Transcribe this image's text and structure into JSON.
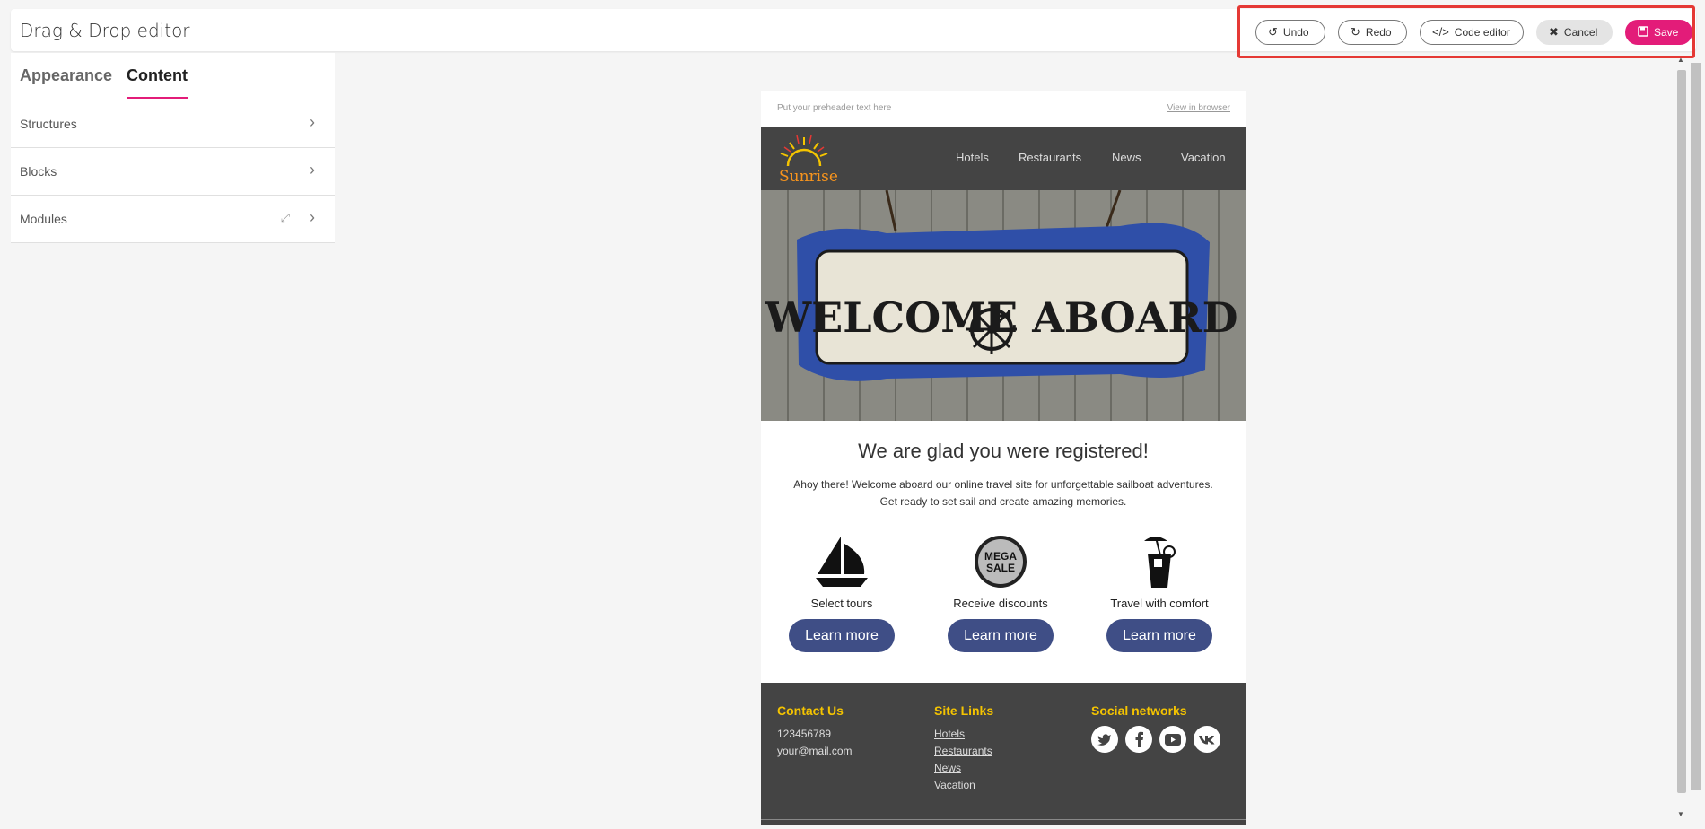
{
  "app": {
    "title": "Drag & Drop editor"
  },
  "toolbar": {
    "undo": "Undo",
    "redo": "Redo",
    "code_editor": "Code editor",
    "cancel": "Cancel",
    "save": "Save",
    "accent_color": "#e31c79",
    "highlight_color": "#e53935"
  },
  "panel": {
    "tabs": [
      "Appearance",
      "Content"
    ],
    "active_tab": "Content",
    "items": [
      {
        "label": "Structures"
      },
      {
        "label": "Blocks"
      },
      {
        "label": "Modules"
      }
    ]
  },
  "email": {
    "preheader": "Put your preheader text here",
    "view_in_browser": "View in browser",
    "logo_text": "Sunrise",
    "nav": [
      "Hotels",
      "Restaurants",
      "News",
      "Vacation"
    ],
    "hero_sign_text": "WELCOME ABOARD",
    "heading": "We are glad you were registered!",
    "paragraph_line1": "Ahoy there! Welcome aboard our online travel site for unforgettable sailboat adventures.",
    "paragraph_line2": "Get ready to set sail and create amazing memories.",
    "features": [
      {
        "icon": "sailboat-icon",
        "caption": "Select tours",
        "button": "Learn more"
      },
      {
        "icon": "mega-sale-icon",
        "caption": "Receive discounts",
        "button": "Learn more",
        "badge_line1": "MEGA",
        "badge_line2": "SALE"
      },
      {
        "icon": "cocktail-icon",
        "caption": "Travel with comfort",
        "button": "Learn more"
      }
    ],
    "footer": {
      "contact_title": "Contact Us",
      "phone": "123456789",
      "email": "your@mail.com",
      "links_title": "Site Links",
      "links": [
        "Hotels",
        "Restaurants",
        "News",
        "Vacation"
      ],
      "social_title": "Social networks",
      "social": [
        "twitter-icon",
        "facebook-icon",
        "youtube-icon",
        "vk-icon"
      ]
    },
    "button_color": "#3f4e86",
    "footer_heading_color": "#f5c400"
  }
}
